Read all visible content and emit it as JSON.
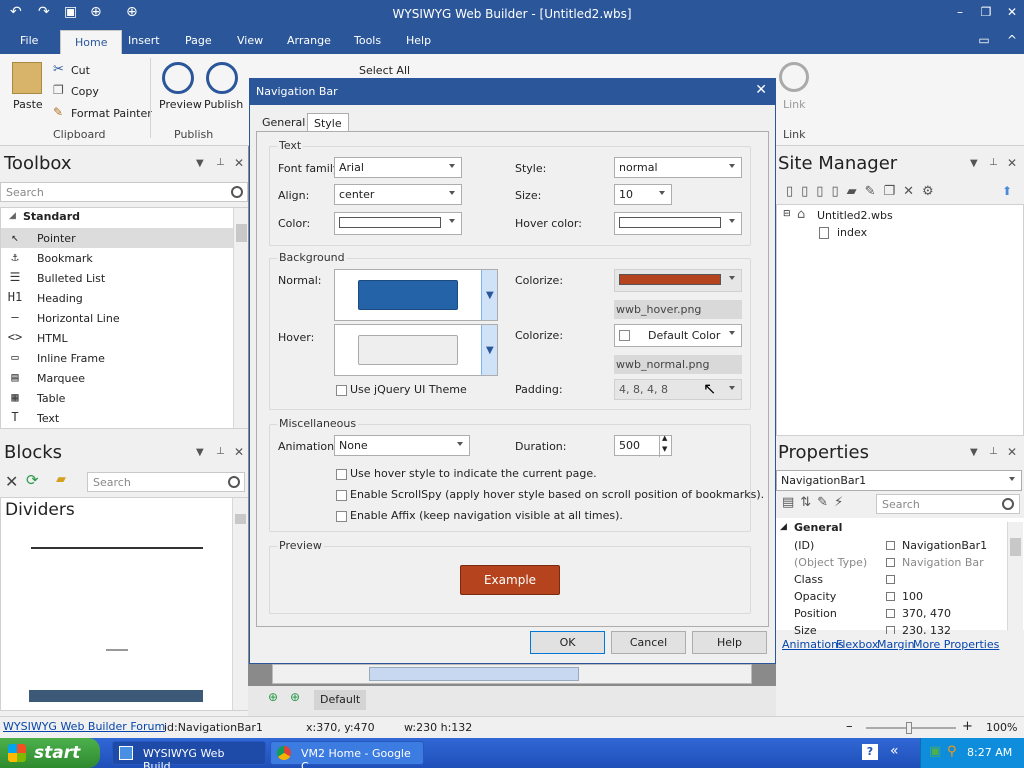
{
  "app": {
    "title": "WYSIWYG Web Builder - [Untitled2.wbs]"
  },
  "ribbon": {
    "tabs": [
      "File",
      "Home",
      "Insert",
      "Page",
      "View",
      "Arrange",
      "Tools",
      "Help"
    ],
    "active_tab": "Home",
    "clipboard": {
      "paste": "Paste",
      "cut": "Cut",
      "copy": "Copy",
      "format_painter": "Format Painter",
      "group": "Clipboard"
    },
    "publish": {
      "preview": "Preview",
      "publish": "Publish",
      "group": "Publish"
    },
    "select_all": "Select All",
    "link": {
      "label": "Link",
      "group": "Link"
    }
  },
  "toolbox": {
    "title": "Toolbox",
    "search_placeholder": "Search",
    "category": "Standard",
    "items": [
      {
        "label": "Pointer",
        "icon": "pointer-icon",
        "glyph": "↖",
        "selected": true
      },
      {
        "label": "Bookmark",
        "icon": "anchor-icon",
        "glyph": "⚓"
      },
      {
        "label": "Bulleted List",
        "icon": "list-icon",
        "glyph": "☰"
      },
      {
        "label": "Heading",
        "icon": "heading-icon",
        "glyph": "H1"
      },
      {
        "label": "Horizontal Line",
        "icon": "hline-icon",
        "glyph": "—"
      },
      {
        "label": "HTML",
        "icon": "html-icon",
        "glyph": "<>"
      },
      {
        "label": "Inline Frame",
        "icon": "iframe-icon",
        "glyph": "▭"
      },
      {
        "label": "Marquee",
        "icon": "marquee-icon",
        "glyph": "▤"
      },
      {
        "label": "Table",
        "icon": "table-icon",
        "glyph": "▦"
      },
      {
        "label": "Text",
        "icon": "text-icon",
        "glyph": "T"
      }
    ]
  },
  "blocks": {
    "title": "Blocks",
    "search_placeholder": "Search",
    "category": "Dividers"
  },
  "site_manager": {
    "title": "Site Manager",
    "root": "Untitled2.wbs",
    "page": "index"
  },
  "properties": {
    "title": "Properties",
    "object": "NavigationBar1",
    "search_placeholder": "Search",
    "group": "General",
    "rows": [
      {
        "name": "(ID)",
        "value": "NavigationBar1"
      },
      {
        "name": "(Object Type)",
        "value": "Navigation Bar",
        "muted": true
      },
      {
        "name": "Class",
        "value": ""
      },
      {
        "name": "Opacity",
        "value": "100"
      },
      {
        "name": "Position",
        "value": "370, 470"
      },
      {
        "name": "Size",
        "value": "230, 132"
      }
    ],
    "links": [
      "Animations",
      "Flexbox",
      "Margin",
      "More Properties"
    ]
  },
  "dialog": {
    "title": "Navigation Bar",
    "tabs": [
      "General",
      "Style"
    ],
    "active_tab": "Style",
    "text_group": {
      "legend": "Text",
      "font_family_label": "Font family:",
      "font_family": "Arial",
      "style_label": "Style:",
      "style": "normal",
      "align_label": "Align:",
      "align": "center",
      "size_label": "Size:",
      "size": "10",
      "color_label": "Color:",
      "hover_color_label": "Hover color:"
    },
    "background_group": {
      "legend": "Background",
      "normal_label": "Normal:",
      "hover_label": "Hover:",
      "colorize_label": "Colorize:",
      "colorize_normal_color": "#b5441e",
      "normal_image": "wwb_hover.png",
      "colorize_hover": "Default Color",
      "hover_image": "wwb_normal.png",
      "jquery_label": "Use jQuery UI Theme",
      "padding_label": "Padding:",
      "padding": "4, 8, 4, 8"
    },
    "misc_group": {
      "legend": "Miscellaneous",
      "animation_label": "Animation:",
      "animation": "None",
      "duration_label": "Duration:",
      "duration": "500",
      "check1": "Use hover style to indicate the current page.",
      "check2": "Enable ScrollSpy (apply hover style based on scroll position of bookmarks).",
      "check3": "Enable Affix (keep navigation visible at all times)."
    },
    "preview_group": {
      "legend": "Preview",
      "button_label": "Example",
      "button_color": "#b5441e"
    },
    "buttons": {
      "ok": "OK",
      "cancel": "Cancel",
      "help": "Help"
    }
  },
  "canvas": {
    "zoom_tab": "Default"
  },
  "status": {
    "forum_link": "WYSIWYG Web Builder Forum",
    "id": "id:NavigationBar1",
    "position": "x:370, y:470",
    "size": "w:230 h:132",
    "zoom": "100%"
  },
  "taskbar": {
    "start": "start",
    "tasks": [
      "WYSIWYG Web Build...",
      "VM2 Home - Google C..."
    ],
    "clock": "8:27 AM"
  },
  "colors": {
    "accent": "#2b579a",
    "nav_normal": "#2563a8",
    "nav_hover": "#eeeeee"
  }
}
